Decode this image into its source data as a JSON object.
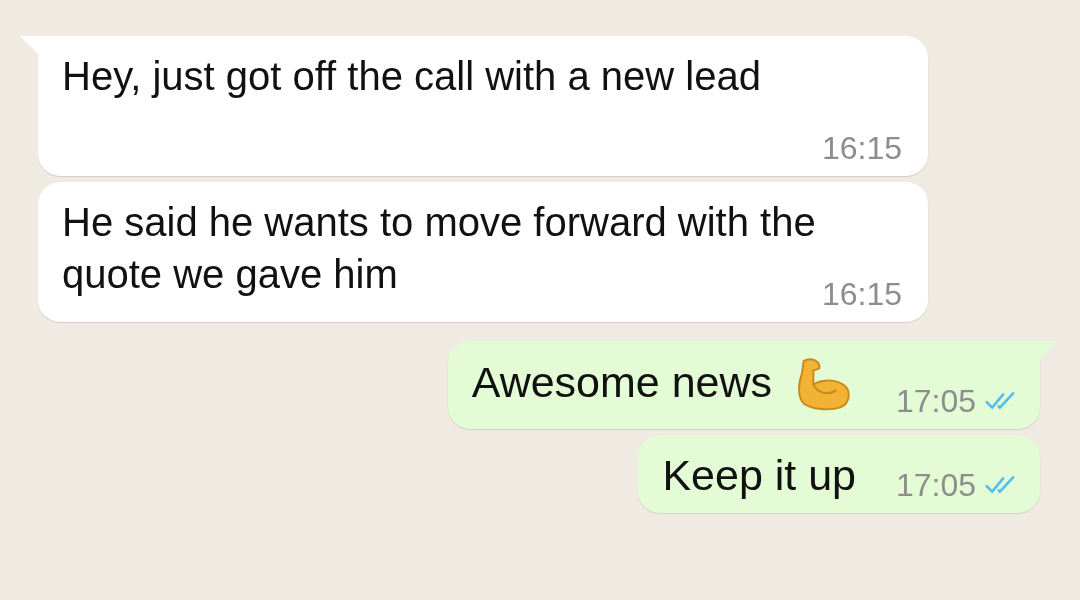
{
  "messages": [
    {
      "kind": "incoming",
      "text": "Hey, just got off the call with a new lead",
      "time": "16:15",
      "tail": true
    },
    {
      "kind": "incoming",
      "text": "He said he wants to move forward with the quote we gave him",
      "time": "16:15",
      "tail": false
    },
    {
      "kind": "outgoing",
      "text": "Awesome news",
      "time": "17:05",
      "tail": true,
      "trailing_icon": true,
      "read": true
    },
    {
      "kind": "outgoing",
      "text": "Keep it up",
      "time": "17:05",
      "tail": false,
      "trailing_icon": false,
      "read": true
    }
  ]
}
